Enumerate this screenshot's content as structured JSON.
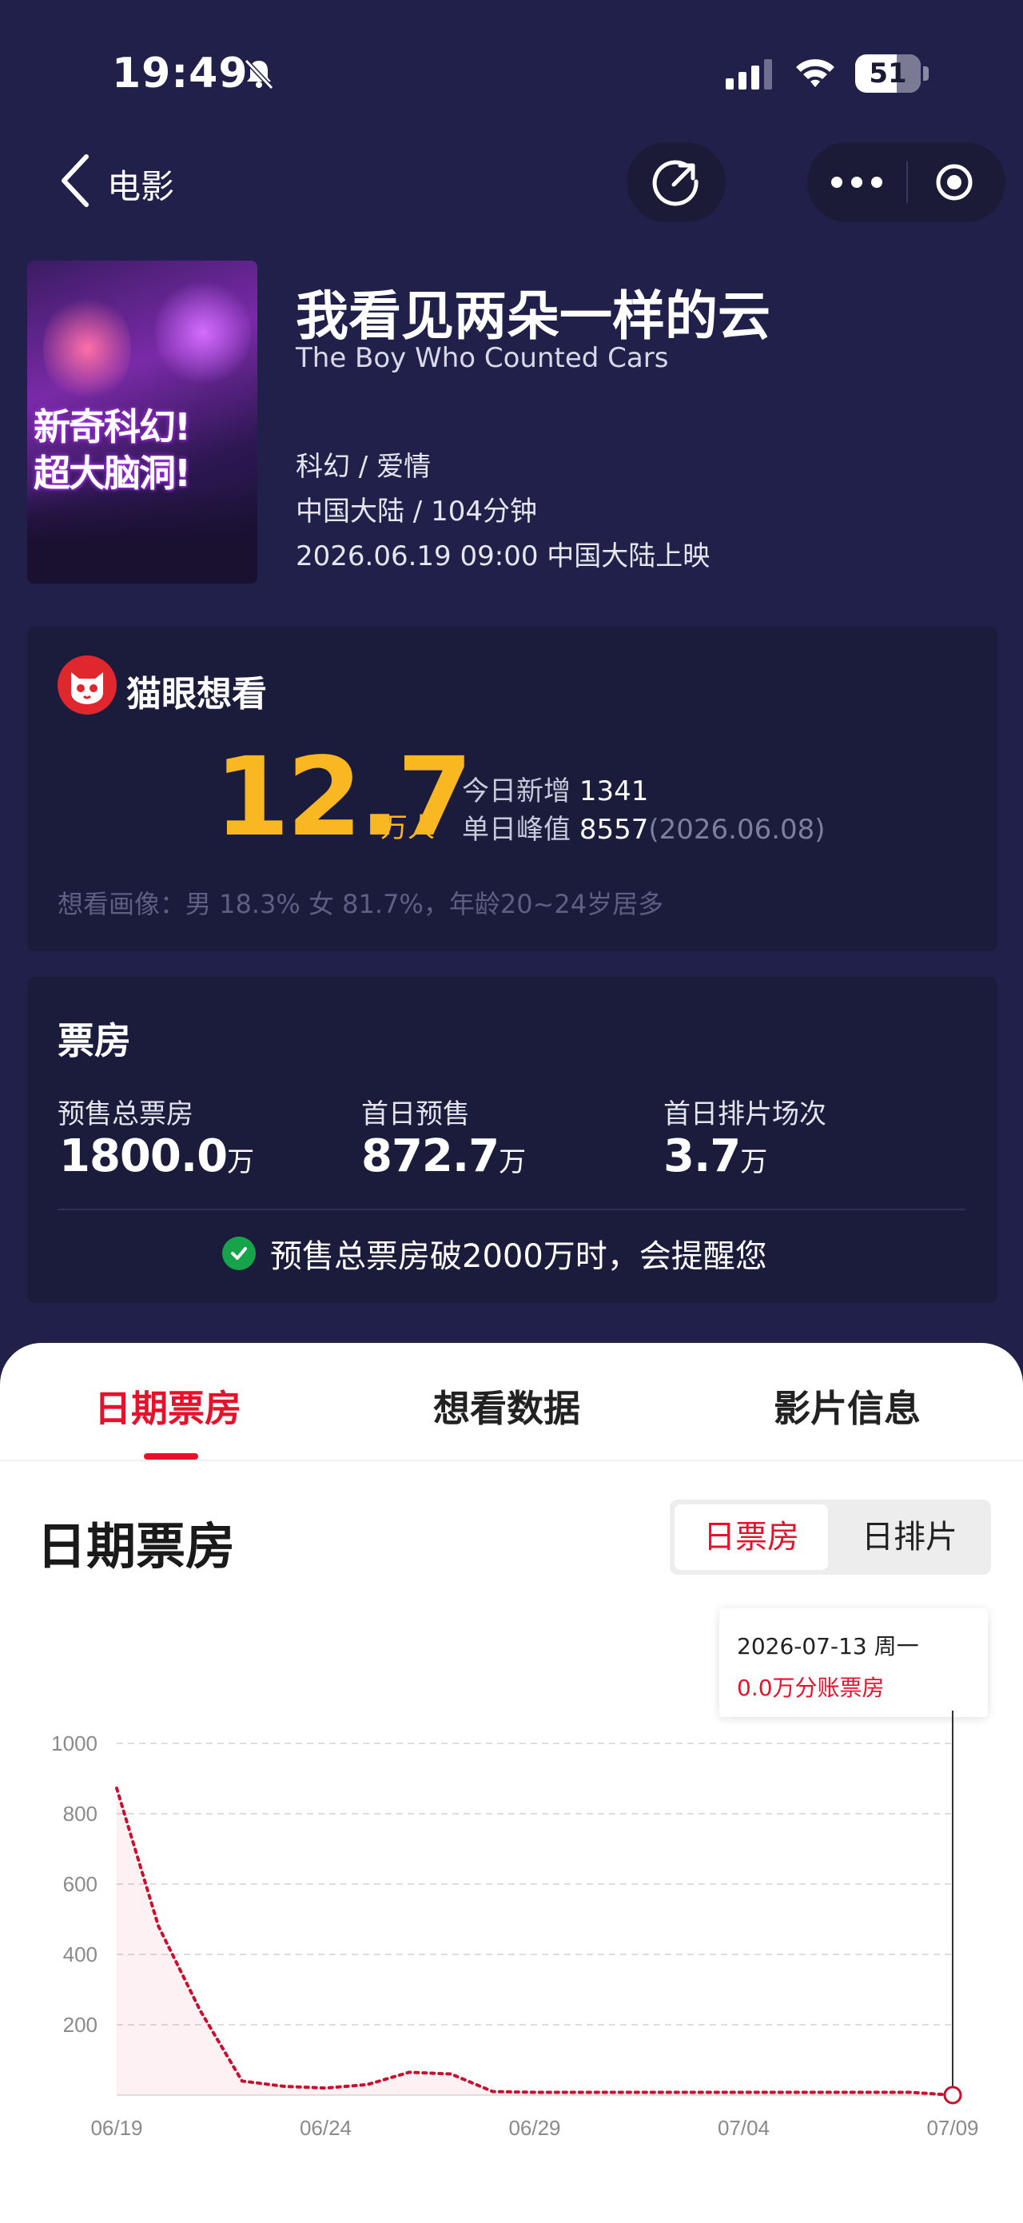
{
  "status_bar": {
    "time": "19:49",
    "battery": "51"
  },
  "nav": {
    "title": "电影"
  },
  "movie": {
    "title_cn": "我看见两朵一样的云",
    "title_en": "The Boy Who Counted Cars",
    "genres": "科幻 / 爱情",
    "region_duration": "中国大陆 / 104分钟",
    "release": "2026.06.19 09:00 中国大陆上映",
    "poster_line1": "新奇科幻!",
    "poster_line2": "超大脑洞!"
  },
  "want": {
    "title": "猫眼想看",
    "count": "12.7",
    "unit": "万人",
    "today_label": "今日新增",
    "today_value": "1341",
    "peak_label": "单日峰值",
    "peak_value": "8557",
    "peak_date": "(2026.06.08)",
    "portrait": "想看画像：男 18.3% 女 81.7%，年龄20~24岁居多"
  },
  "box_office": {
    "title": "票房",
    "stats": [
      {
        "label": "预售总票房",
        "value": "1800.0",
        "unit": "万"
      },
      {
        "label": "首日预售",
        "value": "872.7",
        "unit": "万"
      },
      {
        "label": "首日排片场次",
        "value": "3.7",
        "unit": "万"
      }
    ],
    "remind": "预售总票房破2000万时，会提醒您"
  },
  "tabs": [
    "日期票房",
    "想看数据",
    "影片信息"
  ],
  "section": {
    "title": "日期票房",
    "seg_on": "日票房",
    "seg_off": "日排片"
  },
  "tooltip": {
    "date": "2026-07-13 周一",
    "value": "0.0万分账票房"
  },
  "colors": {
    "accent": "#e6112b",
    "gold": "#f9b722",
    "bg": "#20204a",
    "card": "#1b1b3c"
  },
  "chart_data": {
    "type": "line",
    "x_ticks": [
      "06/19",
      "06/24",
      "06/29",
      "07/04",
      "07/09"
    ],
    "y_ticks": [
      200,
      400,
      600,
      800,
      1000
    ],
    "ylim": [
      0,
      1000
    ],
    "x": [
      "06/19",
      "06/20",
      "06/21",
      "06/22",
      "06/23",
      "06/24",
      "06/25",
      "06/26",
      "06/27",
      "06/28",
      "06/29",
      "06/30",
      "07/01",
      "07/02",
      "07/03",
      "07/04",
      "07/05",
      "07/06",
      "07/07",
      "07/08",
      "07/09"
    ],
    "values": [
      872.7,
      480,
      240,
      40,
      25,
      20,
      30,
      65,
      60,
      10,
      8,
      8,
      8,
      8,
      8,
      8,
      8,
      8,
      8,
      8,
      0
    ],
    "series_color": "#c8102e",
    "line_style": "dotted",
    "highlight_index": 20
  }
}
